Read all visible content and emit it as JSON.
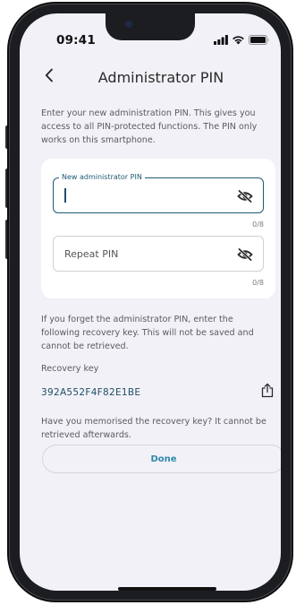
{
  "status_bar": {
    "time": "09:41",
    "icons": [
      "signal-icon",
      "wifi-icon",
      "battery-icon"
    ]
  },
  "nav": {
    "back_icon": "chevron-left-icon",
    "title": "Administrator PIN"
  },
  "intro_text": "Enter your new administration PIN. This gives you access to all PIN-protected functions. The PIN only works on this smartphone.",
  "pin_form": {
    "new_pin": {
      "label": "New administrator PIN",
      "value": "",
      "counter": "0/8",
      "visibility_icon": "eye-off-icon",
      "focused": true
    },
    "repeat_pin": {
      "placeholder": "Repeat PIN",
      "value": "",
      "counter": "0/8",
      "visibility_icon": "eye-off-icon"
    }
  },
  "recovery": {
    "info_text": "If you forget the administrator PIN, enter the following recovery key. This will not be saved and cannot be retrieved.",
    "label": "Recovery key",
    "key": "392A552F4F82E1BE",
    "share_icon": "share-icon",
    "memorised_text": "Have you memorised the recovery key? It cannot be retrieved afterwards."
  },
  "done_button": {
    "label": "Done"
  },
  "colors": {
    "accent": "#1f5a73",
    "button_text": "#2e8aab",
    "screen_background": "#f2f1f7",
    "card_background": "#ffffff",
    "body_text": "#5a5b60"
  }
}
